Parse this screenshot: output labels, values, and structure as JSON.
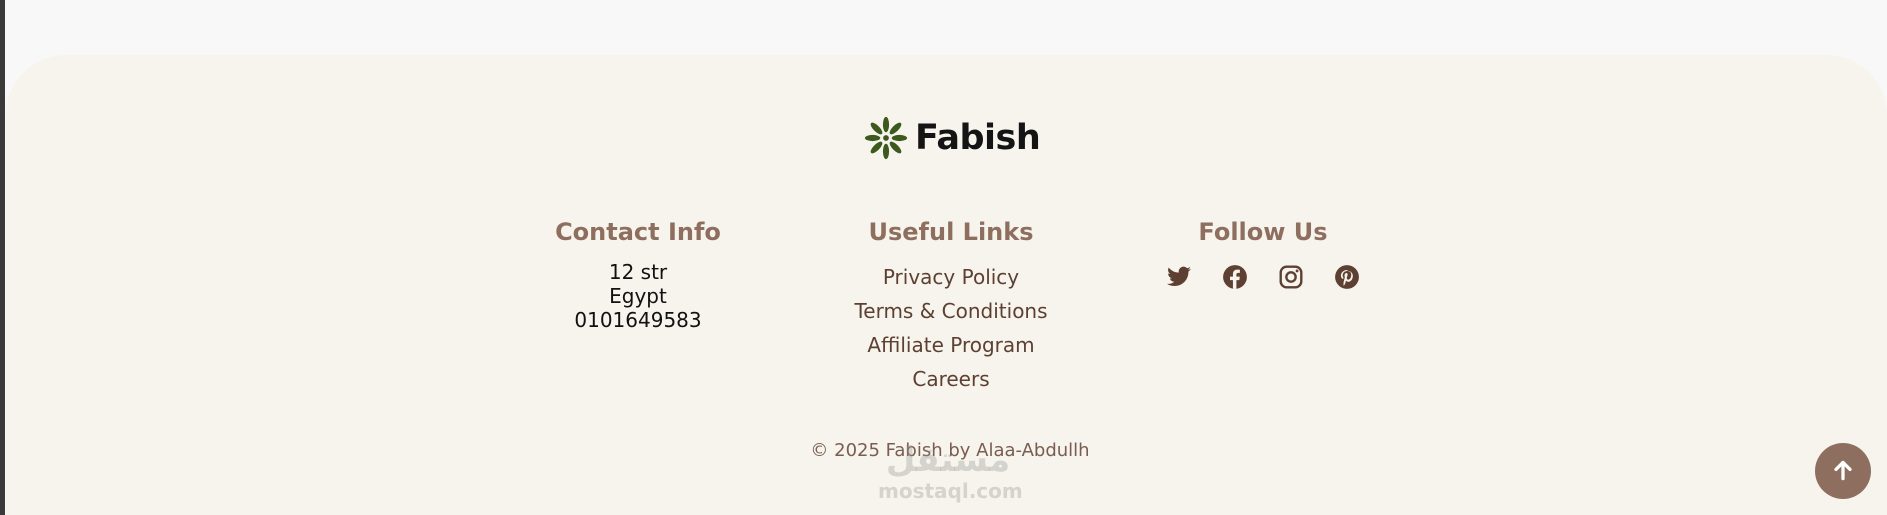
{
  "brand": {
    "name": "Fabish",
    "accent": "#8e6f5f",
    "leaf_color": "#3d5a1e",
    "background": "#f6f4ec"
  },
  "contact": {
    "heading": "Contact Info",
    "lines": [
      "12 str",
      "Egypt",
      "0101649583"
    ]
  },
  "useful_links": {
    "heading": "Useful Links",
    "items": [
      "Privacy Policy",
      "Terms & Conditions",
      "Affiliate Program",
      "Careers"
    ]
  },
  "follow": {
    "heading": "Follow Us",
    "icons": [
      "twitter-icon",
      "facebook-icon",
      "instagram-icon",
      "pinterest-icon"
    ]
  },
  "copyright": "© 2025 Fabish by Alaa-Abdullh",
  "watermark": {
    "arabic": "مستقل",
    "latin": "mostaql.com"
  },
  "scroll_top_icon": "arrow-up-icon"
}
